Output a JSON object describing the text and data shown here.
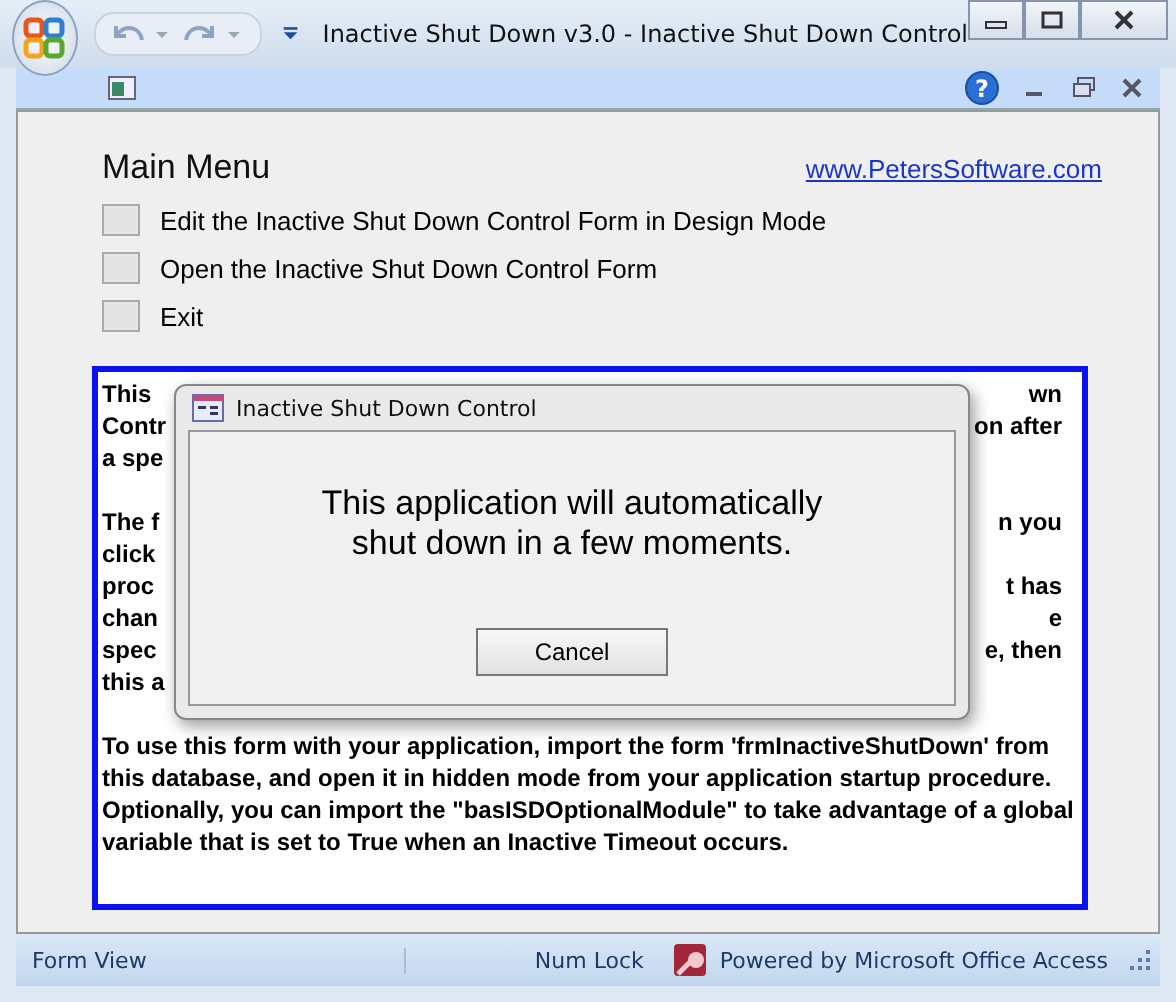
{
  "window": {
    "title": "Inactive Shut Down v3.0  -  Inactive Shut Down Control"
  },
  "help_button": "?",
  "form": {
    "heading": "Main Menu",
    "link": "www.PetersSoftware.com",
    "menu_items": [
      {
        "label": "Edit the Inactive Shut Down Control Form in Design Mode"
      },
      {
        "label": "Open the Inactive Shut Down Control Form"
      },
      {
        "label": "Exit"
      }
    ]
  },
  "info_box": {
    "paragraphs": [
      [
        {
          "left": "This",
          "right": "wn"
        },
        {
          "left": "Contr",
          "right": "on after"
        },
        {
          "left": "a spe"
        }
      ],
      [
        {
          "left": "The f",
          "right": "n you"
        },
        {
          "left": "click"
        },
        {
          "left": "proc",
          "right": "t has"
        },
        {
          "left": "chan",
          "right": "e"
        },
        {
          "left": "spec",
          "right": "e, then"
        },
        {
          "left": "this a"
        }
      ]
    ],
    "last_paragraph": "To use this form with your application, import the form 'frmInactiveShutDown' from this database, and open it in hidden mode from your application startup procedure. Optionally, you can import the \"basISDOptionalModule\" to take advantage of a global variable that is set to True when an Inactive Timeout occurs."
  },
  "dialog": {
    "title": "Inactive Shut Down Control",
    "message_lines": [
      "This application will automatically",
      "shut down in a few moments."
    ],
    "button": "Cancel"
  },
  "status_bar": {
    "view": "Form View",
    "num_lock": "Num Lock",
    "powered_by": "Powered by Microsoft Office Access"
  }
}
